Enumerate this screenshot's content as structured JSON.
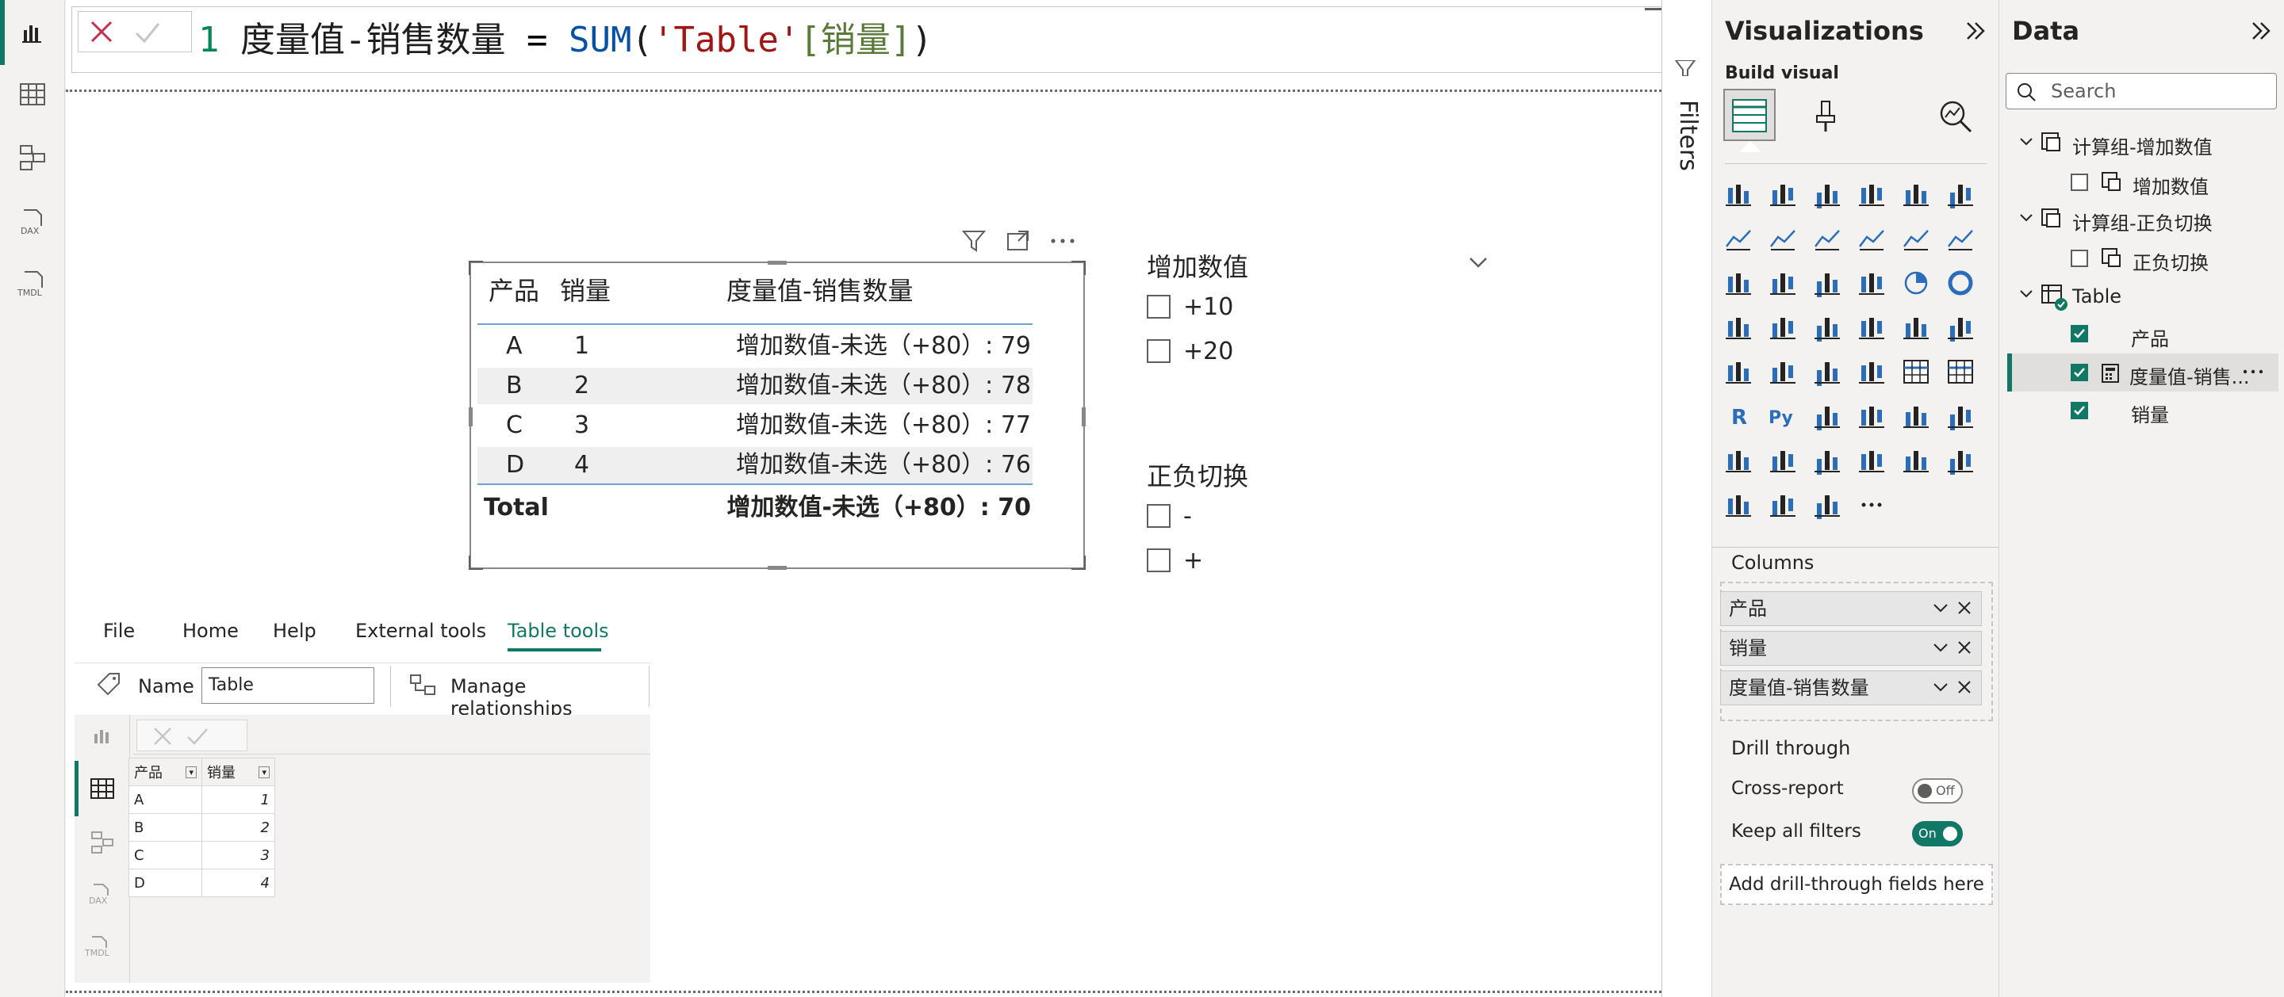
{
  "formula": {
    "line_no": "1",
    "measure_name": "度量值-销售数量",
    "equals": " = ",
    "fn": "SUM",
    "open": "(",
    "table": "'Table'",
    "column": "[销量]",
    "close": ")"
  },
  "table_visual": {
    "headers": [
      "产品",
      "销量",
      "度量值-销售数量"
    ],
    "rows": [
      {
        "product": "A",
        "qty": "1",
        "measure": "增加数值-未选（+80）: 79"
      },
      {
        "product": "B",
        "qty": "2",
        "measure": "增加数值-未选（+80）: 78"
      },
      {
        "product": "C",
        "qty": "3",
        "measure": "增加数值-未选（+80）: 77"
      },
      {
        "product": "D",
        "qty": "4",
        "measure": "增加数值-未选（+80）: 76"
      }
    ],
    "total_label": "Total",
    "total_value": "增加数值-未选（+80）: 70"
  },
  "slicer1": {
    "title": "增加数值",
    "items": [
      "+10",
      "+20"
    ]
  },
  "slicer2": {
    "title": "正负切换",
    "items": [
      "-",
      "+"
    ]
  },
  "inset": {
    "menu": [
      "File",
      "Home",
      "Help",
      "External tools",
      "Table tools"
    ],
    "name_label": "Name",
    "name_value": "Table",
    "manage_relationships": "Manage relationships",
    "grid_headers": [
      "产品",
      "销量"
    ],
    "grid_rows": [
      [
        "A",
        "1"
      ],
      [
        "B",
        "2"
      ],
      [
        "C",
        "3"
      ],
      [
        "D",
        "4"
      ]
    ]
  },
  "filters_label": "Filters",
  "visualizations": {
    "title": "Visualizations",
    "build_visual": "Build visual",
    "columns_label": "Columns",
    "columns": [
      "产品",
      "销量",
      "度量值-销售数量"
    ],
    "drill_through": "Drill through",
    "cross_report": "Cross-report",
    "cross_report_state": "Off",
    "keep_all_filters": "Keep all filters",
    "keep_all_filters_state": "On",
    "add_drill": "Add drill-through fields here"
  },
  "data_pane": {
    "title": "Data",
    "search_placeholder": "Search",
    "groups": [
      {
        "name": "计算组-增加数值",
        "child": "增加数值"
      },
      {
        "name": "计算组-正负切换",
        "child": "正负切换"
      }
    ],
    "table_name": "Table",
    "table_fields": [
      "产品",
      "度量值-销售...",
      "销量"
    ]
  },
  "colors": {
    "accent": "#117865",
    "canvas": "#ffffff",
    "pane": "#f3f2f1"
  }
}
